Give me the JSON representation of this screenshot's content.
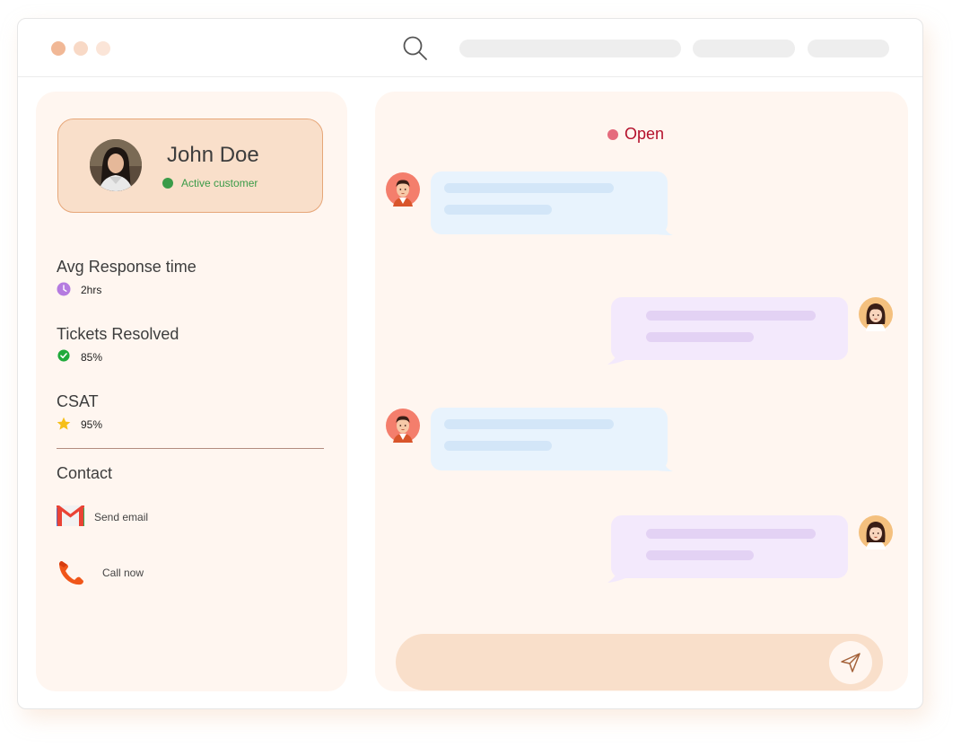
{
  "profile": {
    "name": "John Doe",
    "status": "Active customer"
  },
  "stats": [
    {
      "label": "Avg Response time",
      "value": "2hrs",
      "icon": "clock-icon"
    },
    {
      "label": "Tickets Resolved",
      "value": "85%",
      "icon": "check-circle-icon"
    },
    {
      "label": "CSAT",
      "value": "95%",
      "icon": "star-icon"
    }
  ],
  "contact": {
    "title": "Contact",
    "email_label": "Send email",
    "call_label": "Call now"
  },
  "chat": {
    "status": "Open"
  },
  "colors": {
    "accent_peach": "#f9dfca",
    "panel_bg": "#fff6f0",
    "active_green": "#3a9b48",
    "open_red": "#b4102b",
    "incoming_bubble": "#e8f3fd",
    "outgoing_bubble": "#f3e9fc"
  }
}
